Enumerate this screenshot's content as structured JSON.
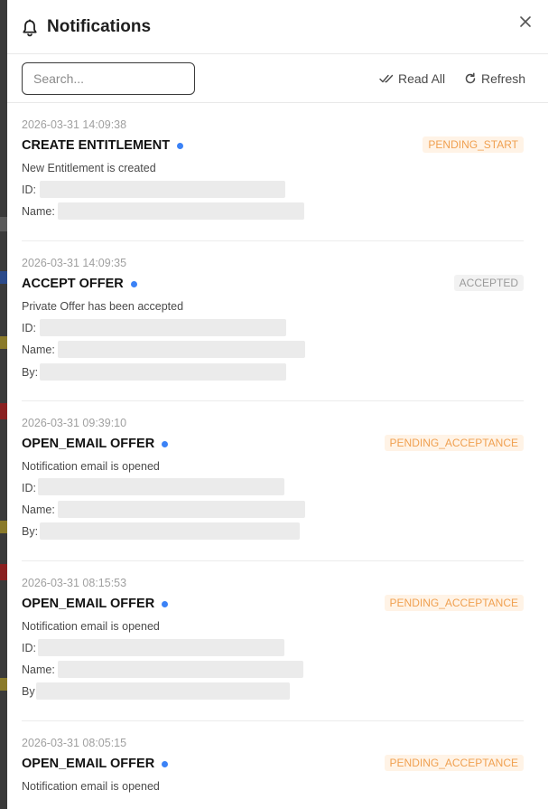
{
  "header": {
    "title": "Notifications"
  },
  "toolbar": {
    "search_placeholder": "Search...",
    "read_all_label": "Read All",
    "refresh_label": "Refresh"
  },
  "colors": {
    "unread_dot": "#3b82f6",
    "badge_orange_text": "#f0a050",
    "badge_orange_bg": "#fff3e6",
    "badge_grey_text": "#9a9a9a",
    "badge_grey_bg": "#f2f2f2"
  },
  "notifications": [
    {
      "timestamp": "2026-03-31 14:09:38",
      "type": "CREATE ENTITLEMENT",
      "status": "PENDING_START",
      "description": "New Entitlement is created",
      "fields": [
        {
          "label": "ID:"
        },
        {
          "label": "Name:"
        }
      ]
    },
    {
      "timestamp": "2026-03-31 14:09:35",
      "type": "ACCEPT OFFER",
      "status": "ACCEPTED",
      "description": "Private Offer has been accepted",
      "fields": [
        {
          "label": "ID:"
        },
        {
          "label": "Name:"
        },
        {
          "label": "By:"
        }
      ]
    },
    {
      "timestamp": "2026-03-31 09:39:10",
      "type": "OPEN_EMAIL OFFER",
      "status": "PENDING_ACCEPTANCE",
      "description": "Notification email is opened",
      "fields": [
        {
          "label": "ID:"
        },
        {
          "label": "Name:"
        },
        {
          "label": "By:"
        }
      ]
    },
    {
      "timestamp": "2026-03-31 08:15:53",
      "type": "OPEN_EMAIL OFFER",
      "status": "PENDING_ACCEPTANCE",
      "description": "Notification email is opened",
      "fields": [
        {
          "label": "ID:"
        },
        {
          "label": "Name:"
        },
        {
          "label": "By"
        }
      ]
    },
    {
      "timestamp": "2026-03-31 08:05:15",
      "type": "OPEN_EMAIL OFFER",
      "status": "PENDING_ACCEPTANCE",
      "description": "Notification email is opened",
      "fields": []
    }
  ]
}
